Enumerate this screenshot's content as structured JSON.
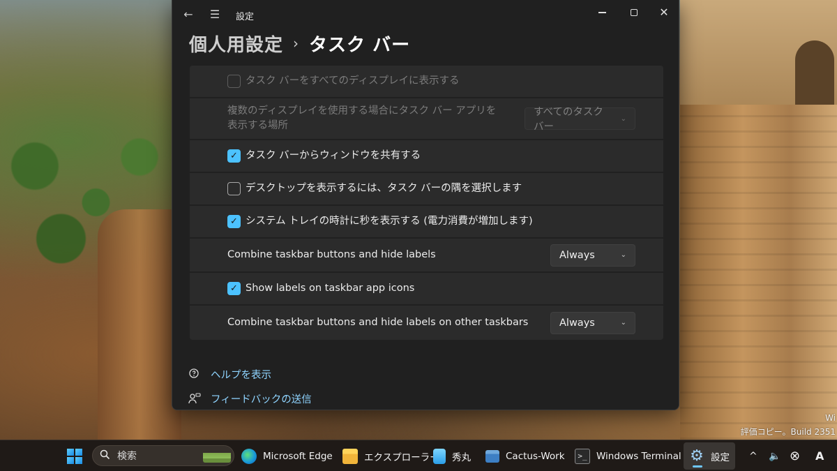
{
  "window": {
    "app_title": "設定",
    "back_glyph": "←",
    "menu_glyph": "☰",
    "close_glyph": "✕"
  },
  "header": {
    "parent": "個人用設定",
    "separator": "›",
    "current": "タスク バー"
  },
  "settings": {
    "rows": [
      {
        "label": "タスク バーをすべてのディスプレイに表示する",
        "type": "checkbox",
        "checked": false,
        "disabled": true
      },
      {
        "label": "複数のディスプレイを使用する場合にタスク バー アプリを表示する場所",
        "type": "dropdown",
        "value": "すべてのタスク バー",
        "disabled": true
      },
      {
        "label": "タスク バーからウィンドウを共有する",
        "type": "checkbox",
        "checked": true,
        "disabled": false
      },
      {
        "label": "デスクトップを表示するには、タスク バーの隅を選択します",
        "type": "checkbox",
        "checked": false,
        "disabled": false
      },
      {
        "label": "システム トレイの時計に秒を表示する (電力消費が増加します)",
        "type": "checkbox",
        "checked": true,
        "disabled": false
      },
      {
        "label": "Combine taskbar buttons and hide labels",
        "type": "dropdown",
        "value": "Always",
        "disabled": false
      },
      {
        "label": "Show labels on taskbar app icons",
        "type": "checkbox",
        "checked": true,
        "disabled": false
      },
      {
        "label": "Combine taskbar buttons and hide labels on other taskbars",
        "type": "dropdown",
        "value": "Always",
        "disabled": false
      }
    ],
    "check_glyph": "✓",
    "chevron_glyph": "⌄"
  },
  "footer": {
    "help": "ヘルプを表示",
    "feedback": "フィードバックの送信"
  },
  "watermark": {
    "line1": "Wi",
    "line2": "評価コピー。Build 2351"
  },
  "taskbar": {
    "search_placeholder": "検索",
    "apps": [
      {
        "label": "Microsoft Edge",
        "icon": "edge-icon"
      },
      {
        "label": "エクスプローラー",
        "icon": "file-explorer-icon"
      },
      {
        "label": "秀丸",
        "icon": "hidemaru-icon"
      },
      {
        "label": "Cactus-Work",
        "icon": "folder-icon"
      },
      {
        "label": "Windows Terminal",
        "icon": "terminal-icon"
      },
      {
        "label": "設定",
        "icon": "settings-gear-icon"
      }
    ],
    "tray": {
      "chevron_glyph": "^",
      "volume_glyph": "🔈",
      "close_glyph": "⊗",
      "ime_glyph": "A"
    }
  },
  "colors": {
    "accent": "#4cc2ff",
    "link": "#8fd4ff",
    "window_bg": "#202020",
    "card_bg": "#2b2b2b"
  }
}
